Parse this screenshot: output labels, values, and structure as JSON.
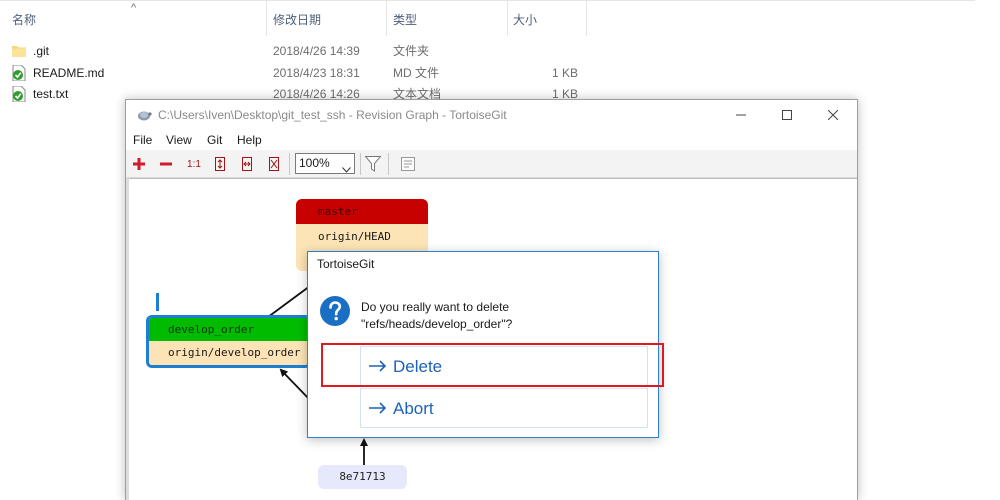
{
  "explorer": {
    "columns": {
      "name": "名称",
      "date": "修改日期",
      "type": "类型",
      "size": "大小"
    },
    "sort_indicator": "^",
    "files": [
      {
        "name": ".git",
        "date": "2018/4/26 14:39",
        "type": "文件夹",
        "size": "",
        "icon": "folder-icon"
      },
      {
        "name": "README.md",
        "date": "2018/4/23 18:31",
        "type": "MD 文件",
        "size": "1 KB",
        "icon": "git-file-icon"
      },
      {
        "name": "test.txt",
        "date": "2018/4/26 14:26",
        "type": "文本文档",
        "size": "1 KB",
        "icon": "git-file-icon"
      }
    ]
  },
  "revision_graph": {
    "title": "C:\\Users\\Iven\\Desktop\\git_test_ssh - Revision Graph - TortoiseGit",
    "menu": [
      "File",
      "View",
      "Git",
      "Help"
    ],
    "toolbar": {
      "zoom_value": "100%",
      "buttons": [
        "zoom-in-icon",
        "zoom-out-icon",
        "zoom-reset-icon",
        "fit-height-icon",
        "fit-width-icon",
        "fit-window-icon",
        "filter-icon",
        "overview-icon"
      ],
      "zoom_reset_label": "1:1"
    },
    "nodes": {
      "master": {
        "label": "master",
        "remote": "origin/HEAD"
      },
      "develop": {
        "label": "develop_order",
        "remote": "origin/develop_order"
      },
      "commit": {
        "label": "8e71713"
      }
    },
    "colors": {
      "master": "#c70000",
      "develop": "#00bb00",
      "remote_ref": "#fde4b6",
      "commit": "#e6e8fb",
      "selection": "#1e7fd0"
    }
  },
  "dialog": {
    "title": "TortoiseGit",
    "icon": "question-icon",
    "message_line1": "Do you really want to delete",
    "message_line2": "\"refs/heads/develop_order\"?",
    "delete_label": "Delete",
    "abort_label": "Abort",
    "highlight_color": "#e0191f"
  }
}
